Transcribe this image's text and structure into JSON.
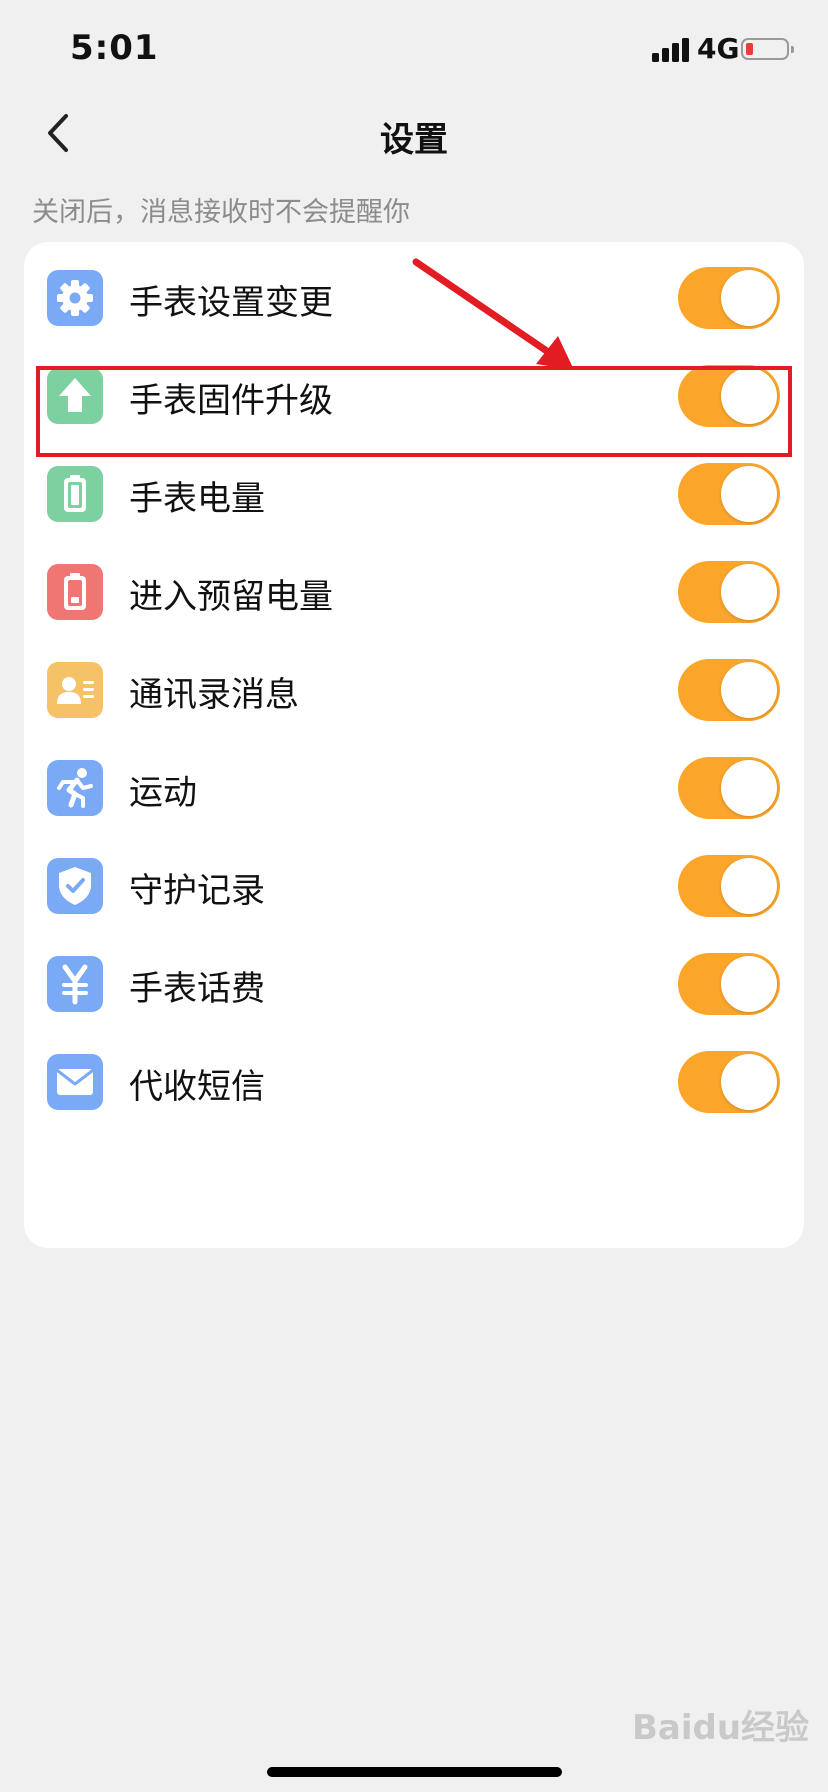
{
  "status_bar": {
    "time": "5:01",
    "network": "4G"
  },
  "header": {
    "title": "设置"
  },
  "hint": "关闭后，消息接收时不会提醒你",
  "colors": {
    "toggle_on": "#fba62a",
    "highlight": "#e31b23"
  },
  "settings": [
    {
      "label": "手表设置变更",
      "icon": "gear-icon",
      "color": "#7aa9f5",
      "on": true
    },
    {
      "label": "手表固件升级",
      "icon": "upload-arrow-icon",
      "color": "#7dd0a0",
      "on": true
    },
    {
      "label": "手表电量",
      "icon": "battery-icon",
      "color": "#7dd0a0",
      "on": true
    },
    {
      "label": "进入预留电量",
      "icon": "low-battery-icon",
      "color": "#ef7672",
      "on": true
    },
    {
      "label": "通讯录消息",
      "icon": "contact-card-icon",
      "color": "#f6c267",
      "on": true
    },
    {
      "label": "运动",
      "icon": "running-person-icon",
      "color": "#7aa9f5",
      "on": true
    },
    {
      "label": "守护记录",
      "icon": "shield-check-icon",
      "color": "#7aa9f5",
      "on": true
    },
    {
      "label": "手表话费",
      "icon": "yuan-icon",
      "color": "#7aa9f5",
      "on": true
    },
    {
      "label": "代收短信",
      "icon": "envelope-icon",
      "color": "#7aa9f5",
      "on": true
    }
  ],
  "watermark": "Baidu经验"
}
